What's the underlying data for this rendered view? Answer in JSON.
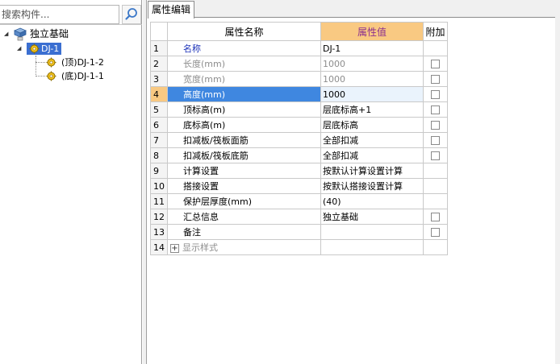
{
  "search": {
    "placeholder": "搜索构件..."
  },
  "tree": {
    "root": {
      "label": "独立基础",
      "icon": "foundation-3d-icon",
      "expanded": true
    },
    "selected": {
      "label": "DJ-1",
      "icon": "gear-icon"
    },
    "children": [
      {
        "label": "(顶)DJ-1-2",
        "icon": "gear-icon"
      },
      {
        "label": "(底)DJ-1-1",
        "icon": "gear-icon"
      }
    ]
  },
  "tabs": [
    {
      "label": "属性编辑",
      "active": true
    }
  ],
  "grid": {
    "headers": {
      "name": "属性名称",
      "value": "属性值",
      "extra": "附加"
    },
    "rows": [
      {
        "num": "1",
        "name": "名称",
        "value": "DJ-1",
        "checkbox": false,
        "style": "blue"
      },
      {
        "num": "2",
        "name": "长度(mm)",
        "value": "1000",
        "checkbox": true,
        "style": "gray"
      },
      {
        "num": "3",
        "name": "宽度(mm)",
        "value": "1000",
        "checkbox": true,
        "style": "gray"
      },
      {
        "num": "4",
        "name": "高度(mm)",
        "value": "1000",
        "checkbox": true,
        "style": "selected"
      },
      {
        "num": "5",
        "name": "顶标高(m)",
        "value": "层底标高+1",
        "checkbox": true,
        "style": "normal"
      },
      {
        "num": "6",
        "name": "底标高(m)",
        "value": "层底标高",
        "checkbox": true,
        "style": "normal"
      },
      {
        "num": "7",
        "name": "扣减板/筏板面筋",
        "value": "全部扣减",
        "checkbox": true,
        "style": "normal"
      },
      {
        "num": "8",
        "name": "扣减板/筏板底筋",
        "value": "全部扣减",
        "checkbox": true,
        "style": "normal"
      },
      {
        "num": "9",
        "name": "计算设置",
        "value": "按默认计算设置计算",
        "checkbox": false,
        "style": "normal"
      },
      {
        "num": "10",
        "name": "搭接设置",
        "value": "按默认搭接设置计算",
        "checkbox": false,
        "style": "normal"
      },
      {
        "num": "11",
        "name": "保护层厚度(mm)",
        "value": "(40)",
        "checkbox": false,
        "style": "normal"
      },
      {
        "num": "12",
        "name": "汇总信息",
        "value": "独立基础",
        "checkbox": true,
        "style": "normal"
      },
      {
        "num": "13",
        "name": "备注",
        "value": "",
        "checkbox": true,
        "style": "normal"
      },
      {
        "num": "14",
        "name": "显示样式",
        "value": "",
        "checkbox": false,
        "style": "expander",
        "expander_symbol": "+"
      }
    ]
  },
  "colors": {
    "selection_blue": "#3f87e0",
    "value_header_bg": "#f9c982",
    "value_header_text": "#8b2f8f",
    "name_blue": "#1c32b8",
    "readonly_gray": "#8d8d8d"
  }
}
